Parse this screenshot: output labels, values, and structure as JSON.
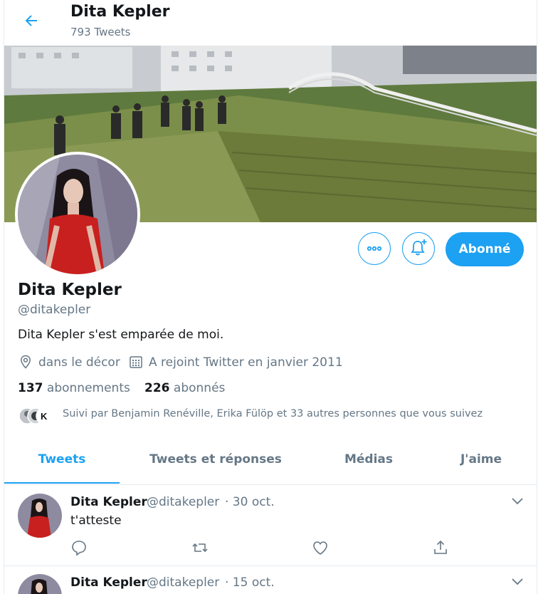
{
  "header": {
    "name": "Dita Kepler",
    "tweet_count": "793 Tweets"
  },
  "profile": {
    "name": "Dita Kepler",
    "handle": "@ditakepler",
    "bio": "Dita Kepler s'est emparée de moi.",
    "location": "dans le décor",
    "joined": "A rejoint Twitter en janvier 2011",
    "following_count": "137",
    "following_label": "abonnements",
    "followers_count": "226",
    "followers_label": "abonnés",
    "followed_by": "Suivi par Benjamin Renéville, Erika Fülöp et 33 autres personnes que vous suivez"
  },
  "actions": {
    "follow_label": "Abonné"
  },
  "tabs": [
    {
      "label": "Tweets"
    },
    {
      "label": "Tweets et réponses"
    },
    {
      "label": "Médias"
    },
    {
      "label": "J'aime"
    }
  ],
  "tweets": [
    {
      "name": "Dita Kepler",
      "handle": "@ditakepler",
      "date": "· 30 oct.",
      "text": "t'atteste"
    },
    {
      "name": "Dita Kepler",
      "handle": "@ditakepler",
      "date": "· 15 oct.",
      "text": ""
    }
  ],
  "colors": {
    "accent": "#1da1f2",
    "secondary_text": "#657786",
    "primary_text": "#14171a"
  },
  "icons": [
    "back-arrow-icon",
    "location-icon",
    "calendar-icon",
    "more-icon",
    "bell-plus-icon",
    "chevron-down-icon",
    "reply-icon",
    "retweet-icon",
    "like-icon",
    "share-icon"
  ]
}
